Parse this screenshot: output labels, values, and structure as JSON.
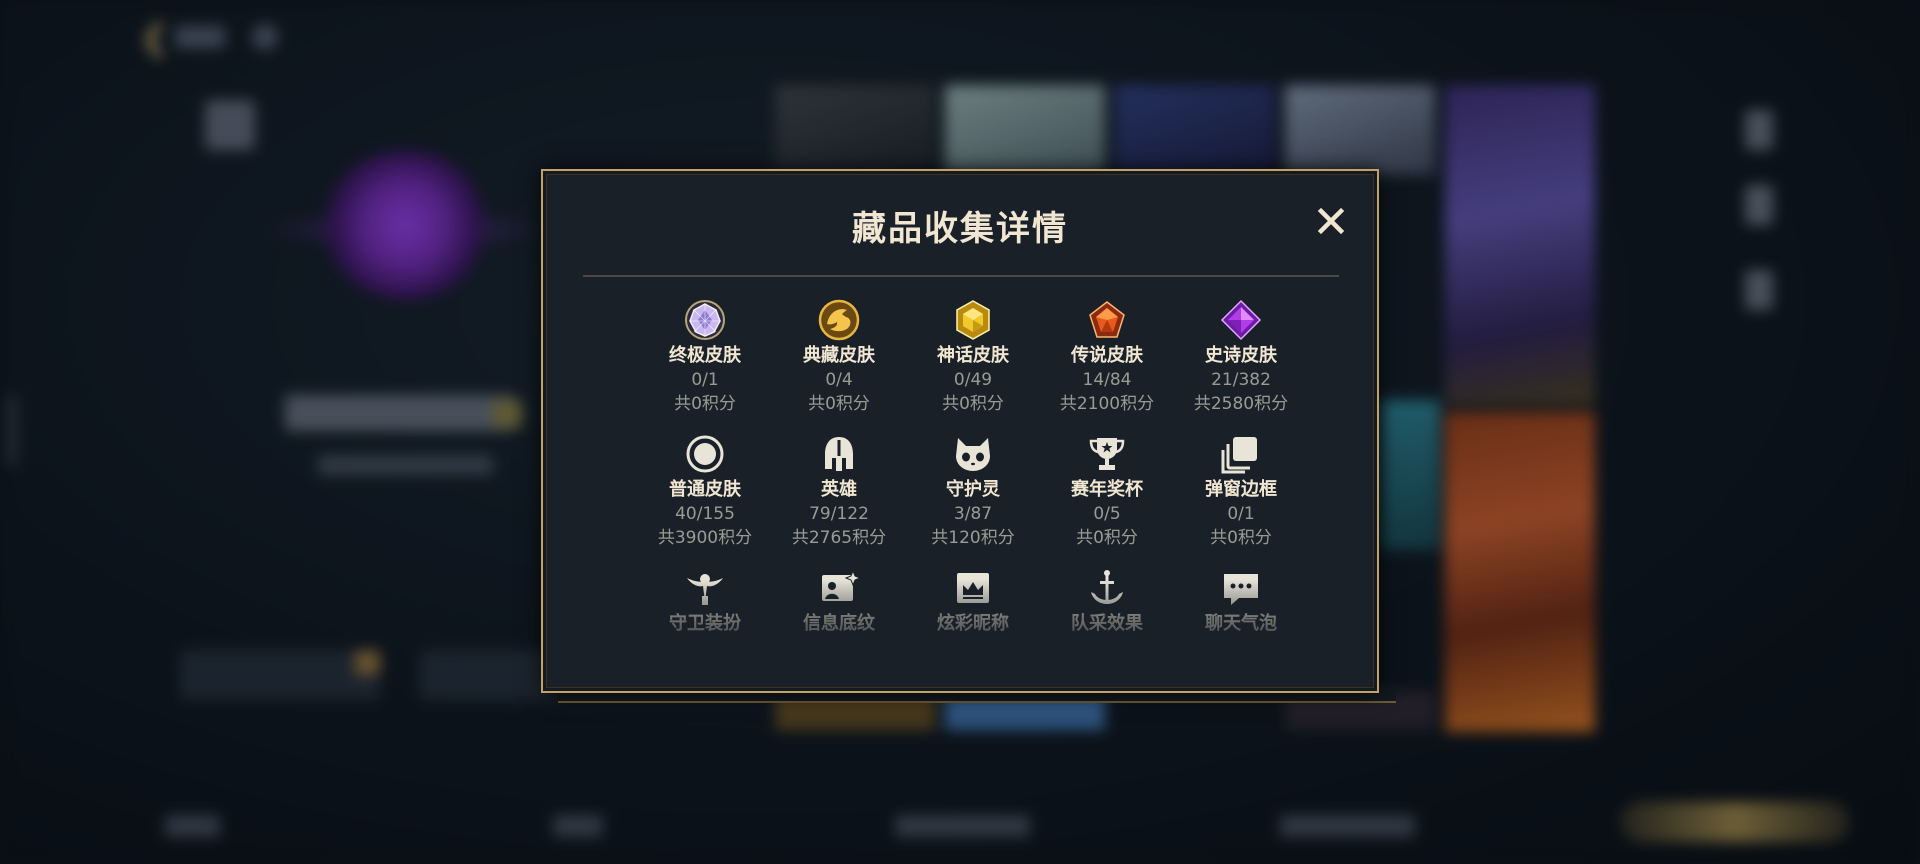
{
  "dialog": {
    "title": "藏品收集详情",
    "close_icon": "close-icon"
  },
  "colors": {
    "gold_border": "#c2a264",
    "title_text": "#f0e6d2",
    "muted_text": "#9a9c93",
    "dialog_bg": "#192028"
  },
  "items": [
    {
      "name": "终极皮肤",
      "count": "0/1",
      "points": "共0积分",
      "icon": "ultimate-skin-gem-icon"
    },
    {
      "name": "典藏皮肤",
      "count": "0/4",
      "points": "共0积分",
      "icon": "prestige-skin-dragon-icon"
    },
    {
      "name": "神话皮肤",
      "count": "0/49",
      "points": "共0积分",
      "icon": "mythic-skin-gem-icon"
    },
    {
      "name": "传说皮肤",
      "count": "14/84",
      "points": "共2100积分",
      "icon": "legendary-skin-gem-icon"
    },
    {
      "name": "史诗皮肤",
      "count": "21/382",
      "points": "共2580积分",
      "icon": "epic-skin-gem-icon"
    },
    {
      "name": "普通皮肤",
      "count": "40/155",
      "points": "共3900积分",
      "icon": "standard-skin-circle-icon"
    },
    {
      "name": "英雄",
      "count": "79/122",
      "points": "共2765积分",
      "icon": "champion-helmet-icon"
    },
    {
      "name": "守护灵",
      "count": "3/87",
      "points": "共120积分",
      "icon": "little-legend-icon"
    },
    {
      "name": "赛年奖杯",
      "count": "0/5",
      "points": "共0积分",
      "icon": "trophy-icon"
    },
    {
      "name": "弹窗边框",
      "count": "0/1",
      "points": "共0积分",
      "icon": "frame-squares-icon"
    },
    {
      "name": "守卫装扮",
      "icon": "ward-skin-icon"
    },
    {
      "name": "信息底纹",
      "icon": "banner-image-icon"
    },
    {
      "name": "炫彩昵称",
      "icon": "crown-nameplate-icon"
    },
    {
      "name": "队采效果",
      "icon": "anchor-effect-icon"
    },
    {
      "name": "聊天气泡",
      "icon": "chat-bubble-icon"
    }
  ]
}
